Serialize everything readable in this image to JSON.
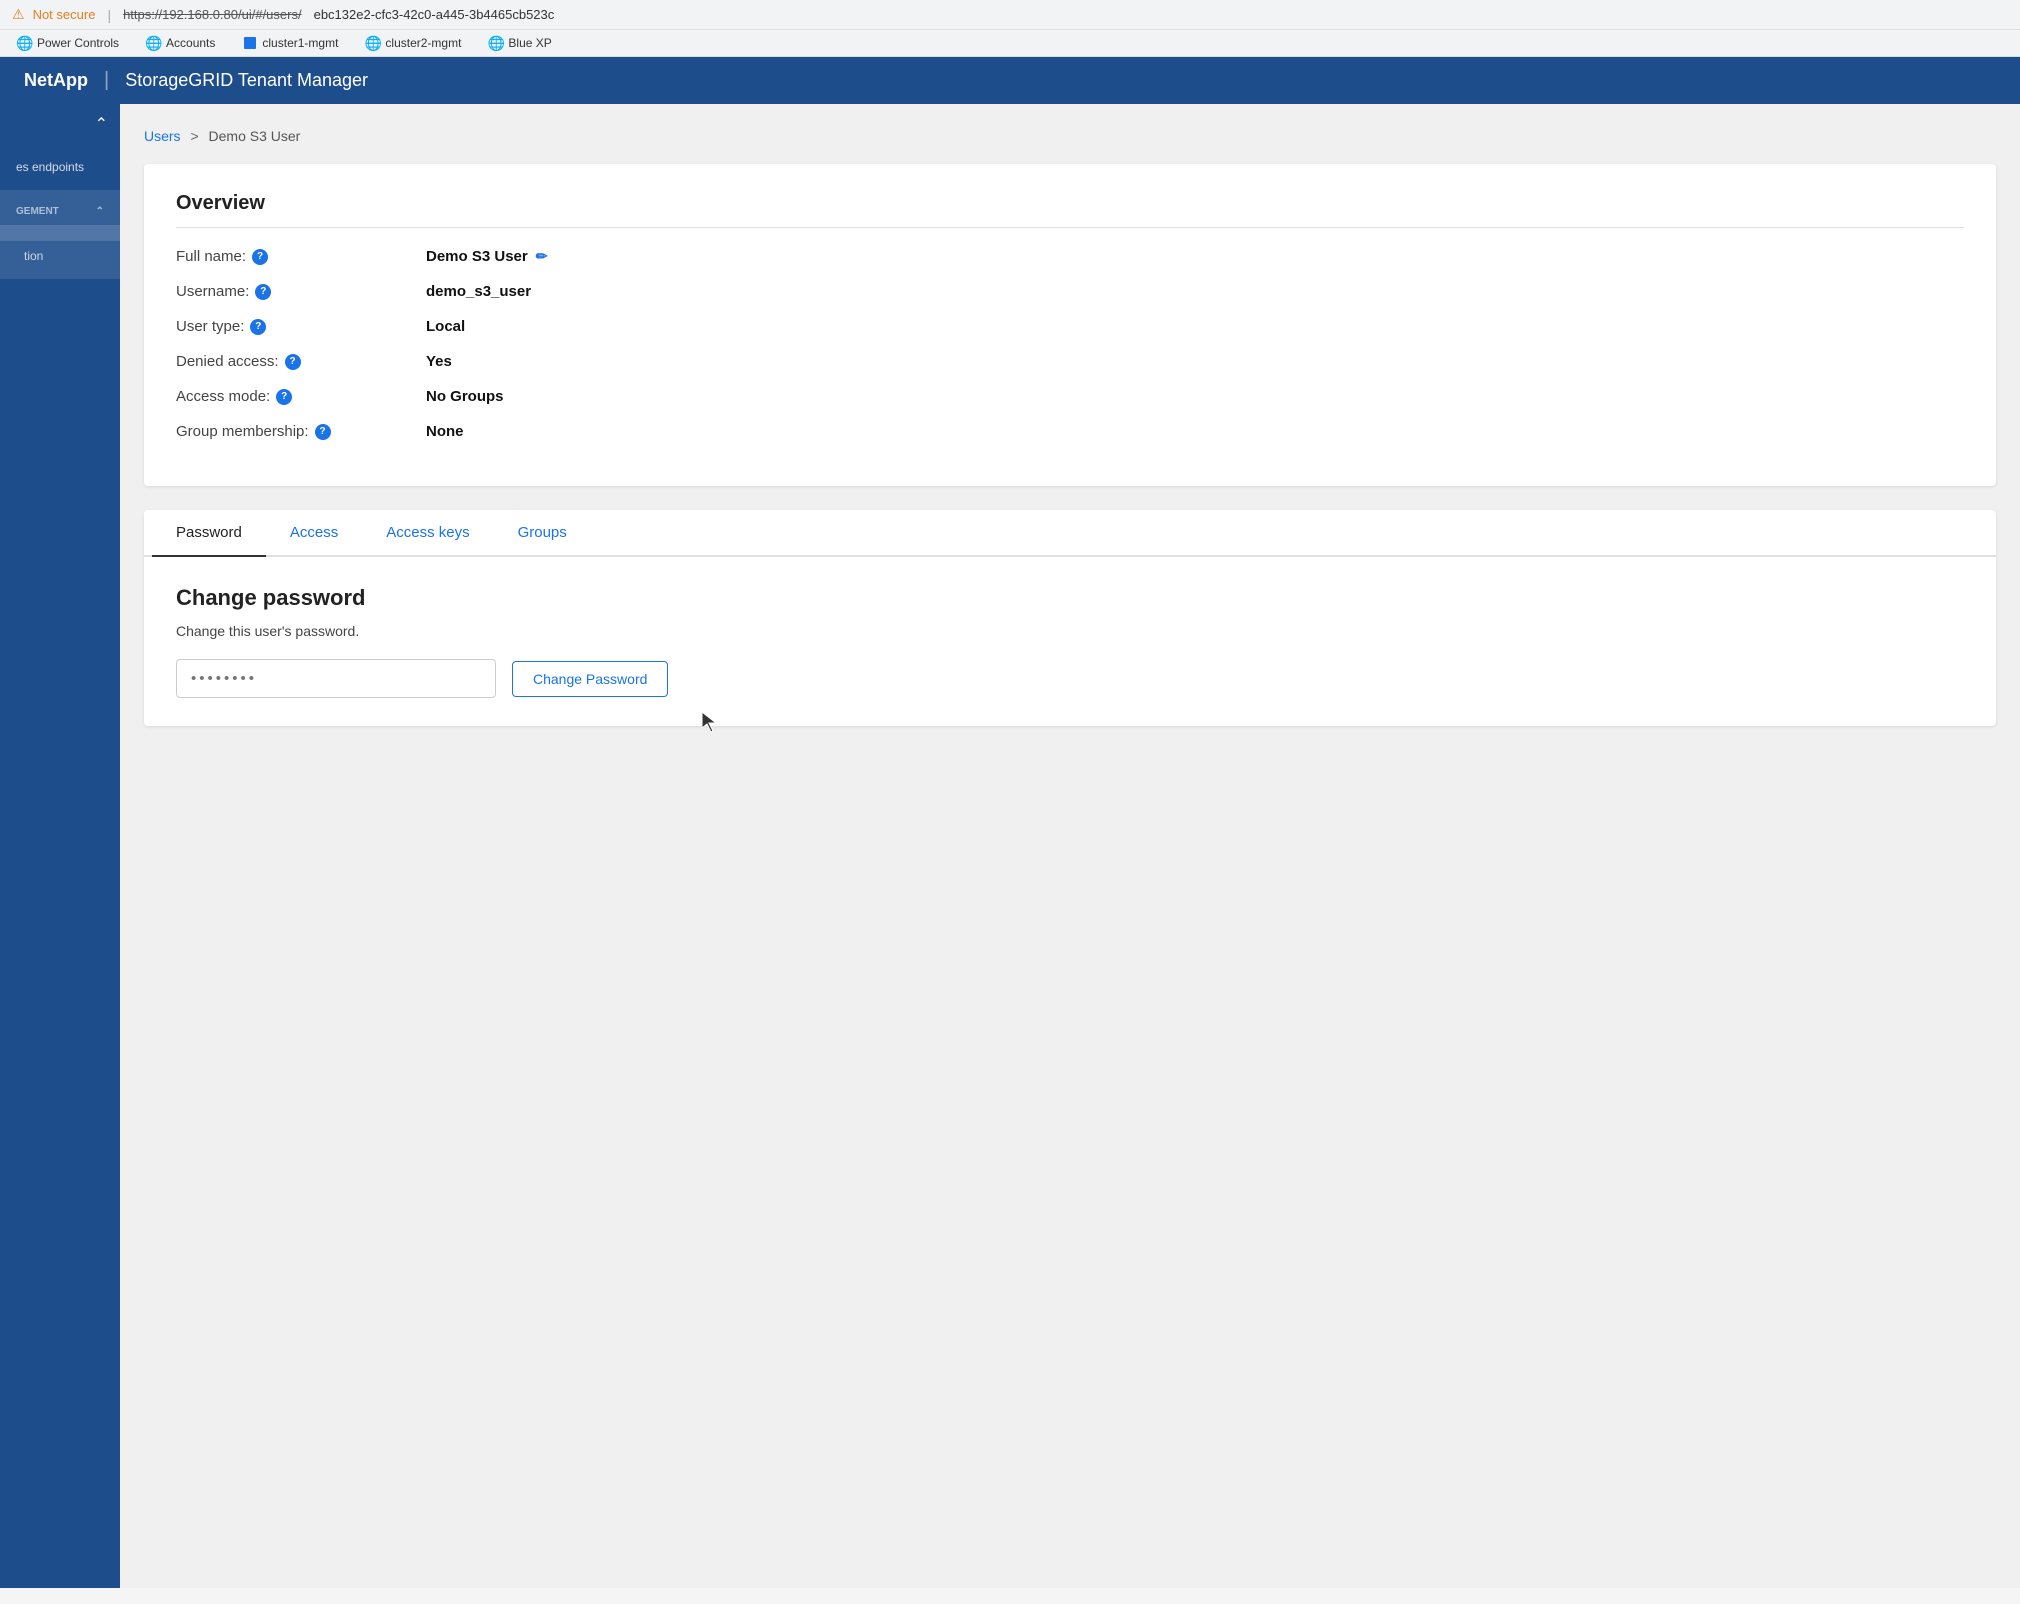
{
  "browser": {
    "warning_text": "Not secure",
    "url_prefix": "https://192.168.0.80/ui/#/users/",
    "url_path": "ebc132e2-cfc3-42c0-a445-3b4465cb523c",
    "bookmarks": [
      {
        "id": "power-controls",
        "label": "Power Controls",
        "icon": "globe"
      },
      {
        "id": "accounts",
        "label": "Accounts",
        "icon": "globe"
      },
      {
        "id": "cluster1-mgmt",
        "label": "cluster1-mgmt",
        "icon": "square"
      },
      {
        "id": "cluster2-mgmt",
        "label": "cluster2-mgmt",
        "icon": "globe"
      },
      {
        "id": "blue-xp",
        "label": "Blue XP",
        "icon": "globe"
      }
    ]
  },
  "header": {
    "brand": "NetApp",
    "divider": "|",
    "title": "StorageGRID Tenant Manager"
  },
  "sidebar": {
    "toggle_icon": "chevron-up",
    "endpoints_label": "es endpoints",
    "management_label": "GEMENT",
    "items": [
      {
        "id": "access-keys",
        "label": "tion"
      }
    ]
  },
  "breadcrumb": {
    "parent": "Users",
    "separator": ">",
    "current": "Demo S3 User"
  },
  "overview": {
    "title": "Overview",
    "fields": [
      {
        "id": "full-name",
        "label": "Full name:",
        "value": "Demo S3 User",
        "has_help": true,
        "has_edit": true
      },
      {
        "id": "username",
        "label": "Username:",
        "value": "demo_s3_user",
        "has_help": true,
        "has_edit": false
      },
      {
        "id": "user-type",
        "label": "User type:",
        "value": "Local",
        "has_help": true,
        "has_edit": false
      },
      {
        "id": "denied-access",
        "label": "Denied access:",
        "value": "Yes",
        "has_help": true,
        "has_edit": false
      },
      {
        "id": "access-mode",
        "label": "Access mode:",
        "value": "No Groups",
        "has_help": true,
        "has_edit": false
      },
      {
        "id": "group-membership",
        "label": "Group membership:",
        "value": "None",
        "has_help": true,
        "has_edit": false
      }
    ]
  },
  "tabs": {
    "items": [
      {
        "id": "password",
        "label": "Password",
        "active": true
      },
      {
        "id": "access",
        "label": "Access",
        "active": false
      },
      {
        "id": "access-keys",
        "label": "Access keys",
        "active": false
      },
      {
        "id": "groups",
        "label": "Groups",
        "active": false
      }
    ]
  },
  "password_section": {
    "title": "Change password",
    "description": "Change this user's password.",
    "input_placeholder": "••••••••",
    "button_label": "Change Password"
  }
}
